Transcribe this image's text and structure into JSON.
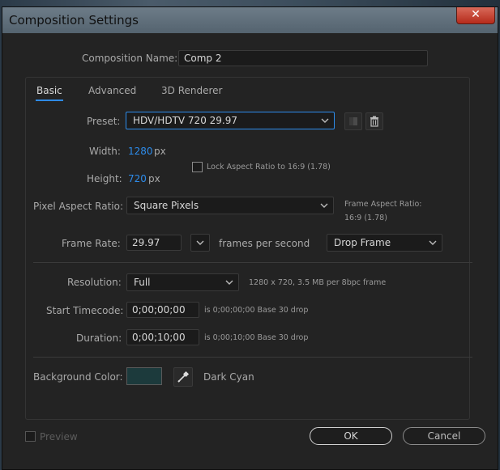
{
  "window": {
    "title": "Composition Settings",
    "close_glyph": "✕"
  },
  "comp_name": {
    "label": "Composition Name:",
    "value": "Comp 2"
  },
  "tabs": [
    {
      "label": "Basic",
      "active": true
    },
    {
      "label": "Advanced",
      "active": false
    },
    {
      "label": "3D Renderer",
      "active": false
    }
  ],
  "preset": {
    "label": "Preset:",
    "value": "HDV/HDTV 720 29.97",
    "save_icon": "save-preset-icon",
    "delete_icon": "trash-icon"
  },
  "width": {
    "label": "Width:",
    "value": "1280",
    "unit": "px"
  },
  "height": {
    "label": "Height:",
    "value": "720",
    "unit": "px"
  },
  "lock_aspect": {
    "label": "Lock Aspect Ratio to 16:9 (1.78)",
    "checked": false
  },
  "pixel_aspect": {
    "label": "Pixel Aspect Ratio:",
    "value": "Square Pixels",
    "frame_aspect_label": "Frame Aspect Ratio:",
    "frame_aspect_value": "16:9 (1.78)"
  },
  "frame_rate": {
    "label": "Frame Rate:",
    "value": "29.97",
    "unit": "frames per second",
    "drop_frame": "Drop Frame"
  },
  "resolution": {
    "label": "Resolution:",
    "value": "Full",
    "info": "1280 x 720, 3.5 MB  per 8bpc frame"
  },
  "start_timecode": {
    "label": "Start Timecode:",
    "value": "0;00;00;00",
    "info": "is 0;00;00;00  Base 30  drop"
  },
  "duration": {
    "label": "Duration:",
    "value": "0;00;10;00",
    "info": "is 0;00;10;00  Base 30  drop"
  },
  "background": {
    "label": "Background Color:",
    "swatch": "#1c3a3c",
    "name": "Dark Cyan",
    "eyedropper_icon": "eyedropper-icon"
  },
  "footer": {
    "preview_label": "Preview",
    "ok_label": "OK",
    "cancel_label": "Cancel"
  },
  "colors": {
    "accent": "#2d8ceb",
    "dialog_bg": "#232323",
    "titlebar": "#5f6e7a",
    "close": "#c8412f"
  }
}
